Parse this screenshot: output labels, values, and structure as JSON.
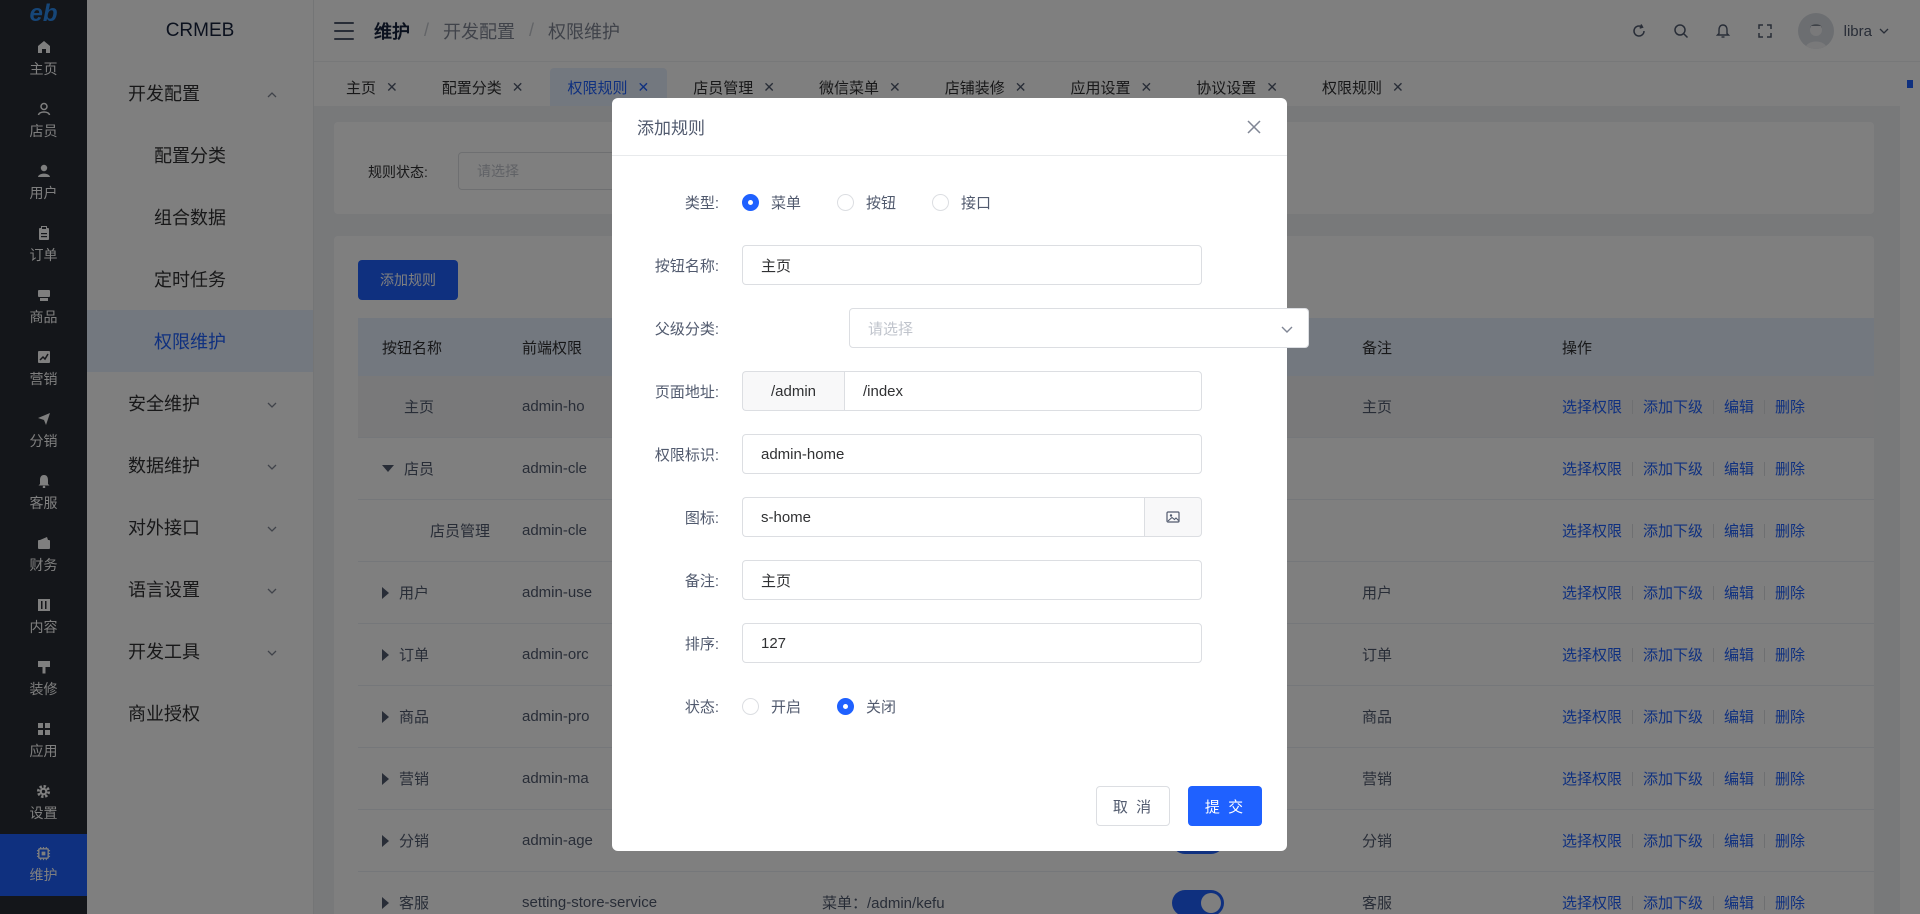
{
  "rail": {
    "logo": "eb",
    "items": [
      {
        "label": "主页",
        "icon": "home-icon"
      },
      {
        "label": "店员",
        "icon": "person-outline-icon"
      },
      {
        "label": "用户",
        "icon": "person-icon"
      },
      {
        "label": "订单",
        "icon": "clipboard-icon"
      },
      {
        "label": "商品",
        "icon": "box-icon"
      },
      {
        "label": "营销",
        "icon": "chart-icon"
      },
      {
        "label": "分销",
        "icon": "send-icon"
      },
      {
        "label": "客服",
        "icon": "bell-icon"
      },
      {
        "label": "财务",
        "icon": "wallet-icon"
      },
      {
        "label": "内容",
        "icon": "book-icon"
      },
      {
        "label": "装修",
        "icon": "brush-icon"
      },
      {
        "label": "应用",
        "icon": "grid-icon"
      },
      {
        "label": "设置",
        "icon": "gear-icon"
      },
      {
        "label": "维护",
        "icon": "chip-icon"
      }
    ]
  },
  "submenu": {
    "brand": "CRMEB",
    "groups": [
      {
        "label": "开发配置",
        "children": [
          "配置分类",
          "组合数据",
          "定时任务",
          "权限维护"
        ]
      },
      {
        "label": "安全维护"
      },
      {
        "label": "数据维护"
      },
      {
        "label": "对外接口"
      },
      {
        "label": "语言设置"
      },
      {
        "label": "开发工具"
      },
      {
        "label": "商业授权"
      }
    ]
  },
  "header": {
    "crumbs": [
      "维护",
      "开发配置",
      "权限维护"
    ],
    "separator": "/",
    "user": "libra"
  },
  "tabs": [
    {
      "label": "主页"
    },
    {
      "label": "配置分类"
    },
    {
      "label": "权限规则"
    },
    {
      "label": "店员管理"
    },
    {
      "label": "微信菜单"
    },
    {
      "label": "店铺装修"
    },
    {
      "label": "应用设置"
    },
    {
      "label": "协议设置"
    },
    {
      "label": "权限规则"
    }
  ],
  "filter": {
    "label": "规则状态:",
    "placeholder": "请选择"
  },
  "table": {
    "add_button": "添加规则",
    "headers": [
      "按钮名称",
      "前端权限",
      "",
      "",
      "备注",
      "操作"
    ],
    "ops": [
      "选择权限",
      "添加下级",
      "编辑",
      "删除"
    ],
    "rows": [
      {
        "name": "主页",
        "perm": "admin-ho",
        "note": "主页"
      },
      {
        "name": "店员",
        "perm": "admin-cle",
        "note": ""
      },
      {
        "name": "店员管理",
        "perm": "admin-cle",
        "note": ""
      },
      {
        "name": "用户",
        "perm": "admin-use",
        "note": "用户"
      },
      {
        "name": "订单",
        "perm": "admin-orc",
        "note": "订单"
      },
      {
        "name": "商品",
        "perm": "admin-pro",
        "note": "商品"
      },
      {
        "name": "营销",
        "perm": "admin-ma",
        "note": "营销"
      },
      {
        "name": "分销",
        "perm": "admin-age",
        "note": "分销"
      },
      {
        "name": "客服",
        "perm": "setting-store-service",
        "route": "菜单：/admin/kefu",
        "note": "客服"
      }
    ]
  },
  "modal": {
    "title": "添加规则",
    "type_label": "类型:",
    "type_options": [
      "菜单",
      "按钮",
      "接口"
    ],
    "name_label": "按钮名称:",
    "name_value": "主页",
    "parent_label": "父级分类:",
    "parent_placeholder": "请选择",
    "path_label": "页面地址:",
    "path_prefix": "/admin",
    "path_value": "/index",
    "perm_label": "权限标识:",
    "perm_value": "admin-home",
    "icon_label": "图标:",
    "icon_value": "s-home",
    "note_label": "备注:",
    "note_value": "主页",
    "sort_label": "排序:",
    "sort_value": "127",
    "status_label": "状态:",
    "status_options": [
      "开启",
      "关闭"
    ],
    "cancel": "取 消",
    "submit": "提 交"
  }
}
